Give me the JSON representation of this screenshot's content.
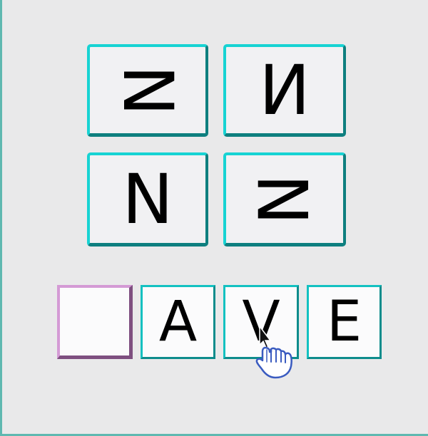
{
  "choices": [
    {
      "id": "z-rotated",
      "letter": "N"
    },
    {
      "id": "n-mirrored",
      "letter": "N"
    },
    {
      "id": "n-normal",
      "letter": "N"
    },
    {
      "id": "z-rotated-ccw",
      "letter": "N"
    }
  ],
  "word": {
    "slots": [
      "",
      "A",
      "V",
      "E"
    ]
  },
  "icons": {
    "pointer": "hand-pointer-icon"
  },
  "colors": {
    "tile_light": "#17d3d3",
    "tile_dark": "#0e7f7f",
    "empty_slot_light": "#d49ad5",
    "empty_slot_dark": "#7e4f80"
  }
}
